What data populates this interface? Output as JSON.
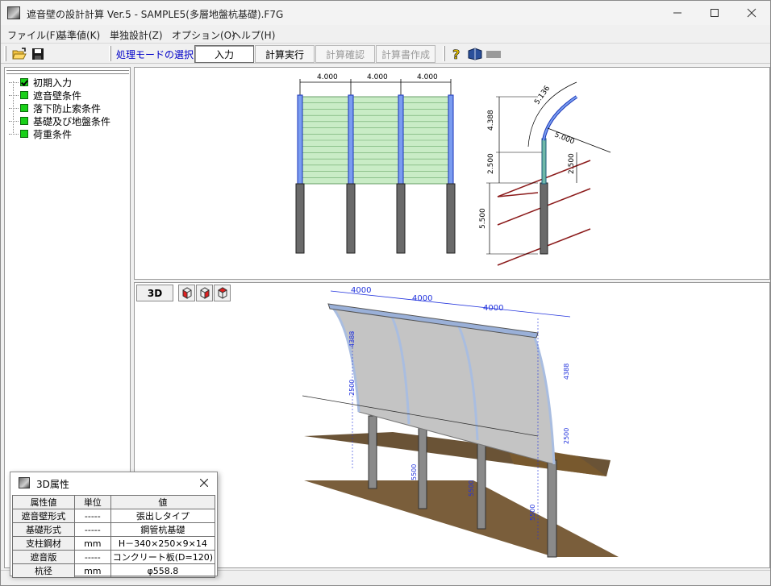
{
  "window": {
    "title": "遮音壁の設計計算 Ver.5 - SAMPLE5(多層地盤杭基礎).F7G"
  },
  "menu": [
    "ファイル(F)",
    "基準値(K)",
    "単独設計(Z)",
    "オプション(O)",
    "ヘルプ(H)"
  ],
  "toolbar": {
    "mode_label": "処理モードの選択",
    "buttons": [
      "入力",
      "計算実行",
      "計算確認",
      "計算書作成"
    ]
  },
  "tree": [
    "初期入力",
    "遮音壁条件",
    "落下防止索条件",
    "基礎及び地盤条件",
    "荷重条件"
  ],
  "drawing": {
    "spans": [
      "4.000",
      "4.000",
      "4.000"
    ],
    "section_dims": {
      "arc": "5.136",
      "height_upper": "4.388",
      "radius": "5.000",
      "height_mid": "2.500",
      "height_mid_right": "2.500",
      "pile": "5.500"
    }
  },
  "view3d": {
    "button_label": "3D",
    "dims": [
      "4000",
      "4000",
      "4000"
    ],
    "small_labels": {
      "top_left": "4388",
      "left_mid": "2500",
      "right_top": "4388",
      "right_mid": "2500",
      "pile_a": "5500",
      "pile_b": "5500",
      "pile_c": "5500"
    }
  },
  "props_dialog": {
    "title": "3D属性",
    "columns": [
      "属性値",
      "単位",
      "値"
    ],
    "rows": [
      {
        "name": "遮音壁形式",
        "unit": "-----",
        "value": "張出しタイプ"
      },
      {
        "name": "基礎形式",
        "unit": "-----",
        "value": "鋼管杭基礎"
      },
      {
        "name": "支柱鋼材",
        "unit": "mm",
        "value": "H－340×250×9×14"
      },
      {
        "name": "遮音版",
        "unit": "-----",
        "value": "コンクリート板(D=120)"
      },
      {
        "name": "杭径",
        "unit": "mm",
        "value": "φ558.8"
      }
    ]
  }
}
